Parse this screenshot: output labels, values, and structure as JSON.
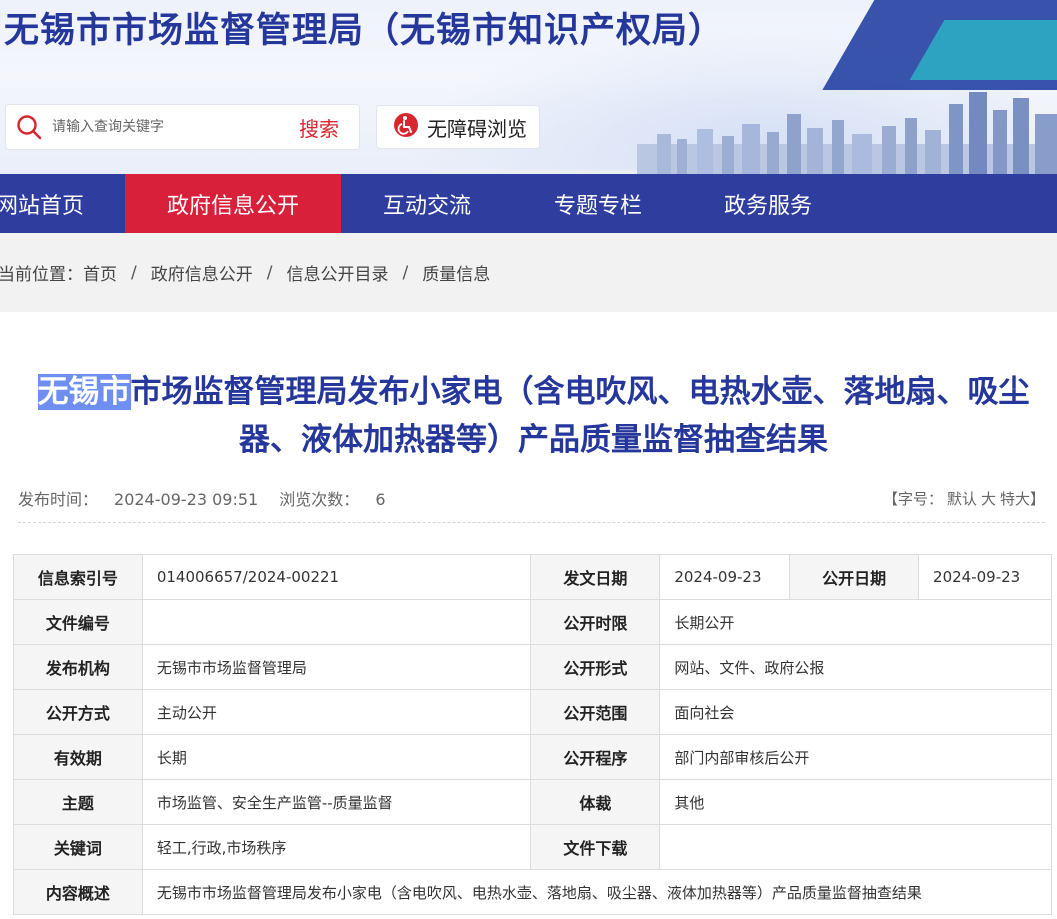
{
  "header": {
    "site_title": "无锡市市场监督管理局（无锡市知识产权局）",
    "search_placeholder": "请输入查询关键字",
    "search_button": "搜索",
    "accessibility_button": "无障碍浏览"
  },
  "nav": {
    "items": [
      {
        "label": "网站首页"
      },
      {
        "label": "政府信息公开"
      },
      {
        "label": "互动交流"
      },
      {
        "label": "专题专栏"
      },
      {
        "label": "政务服务"
      }
    ]
  },
  "breadcrumb": {
    "prefix": "当前位置：",
    "items": [
      "首页",
      "政府信息公开",
      "信息公开目录",
      "质量信息"
    ],
    "separator": "/"
  },
  "article": {
    "title_highlight": "无锡市",
    "title_rest_line1": "市场监督管理局发布小家电（含电吹风、电热水壶、落地扇、吸尘",
    "title_line2": "器、液体加热器等）产品质量监督抽查结果",
    "publish_label": "发布时间：",
    "publish_time": "2024-09-23 09:51",
    "views_label": "浏览次数：",
    "views": "6",
    "font_size_label": "【字号：",
    "font_default": "默认",
    "font_large": "大",
    "font_xlarge": "特大】"
  },
  "info": {
    "index_no_label": "信息索引号",
    "index_no": "014006657/2024-00221",
    "doc_date_label": "发文日期",
    "doc_date": "2024-09-23",
    "pub_date_label": "公开日期",
    "pub_date": "2024-09-23",
    "doc_no_label": "文件编号",
    "doc_no": "",
    "pub_period_label": "公开时限",
    "pub_period": "长期公开",
    "org_label": "发布机构",
    "org": "无锡市市场监督管理局",
    "pub_form_label": "公开形式",
    "pub_form": "网站、文件、政府公报",
    "pub_method_label": "公开方式",
    "pub_method": "主动公开",
    "pub_scope_label": "公开范围",
    "pub_scope": "面向社会",
    "validity_label": "有效期",
    "validity": "长期",
    "pub_proc_label": "公开程序",
    "pub_proc": "部门内部审核后公开",
    "topic_label": "主题",
    "topic": "市场监管、安全生产监管--质量监督",
    "genre_label": "体裁",
    "genre": "其他",
    "keywords_label": "关键词",
    "keywords": "轻工,行政,市场秩序",
    "download_label": "文件下载",
    "download": "",
    "summary_label": "内容概述",
    "summary": "无锡市市场监督管理局发布小家电（含电吹风、电热水壶、落地扇、吸尘器、液体加热器等）产品质量监督抽查结果"
  },
  "colors": {
    "brand_blue": "#2f3e9e",
    "title_blue": "#25379a",
    "active_red": "#d8203a",
    "search_red": "#d8262f",
    "highlight": "#6f8ff0"
  }
}
